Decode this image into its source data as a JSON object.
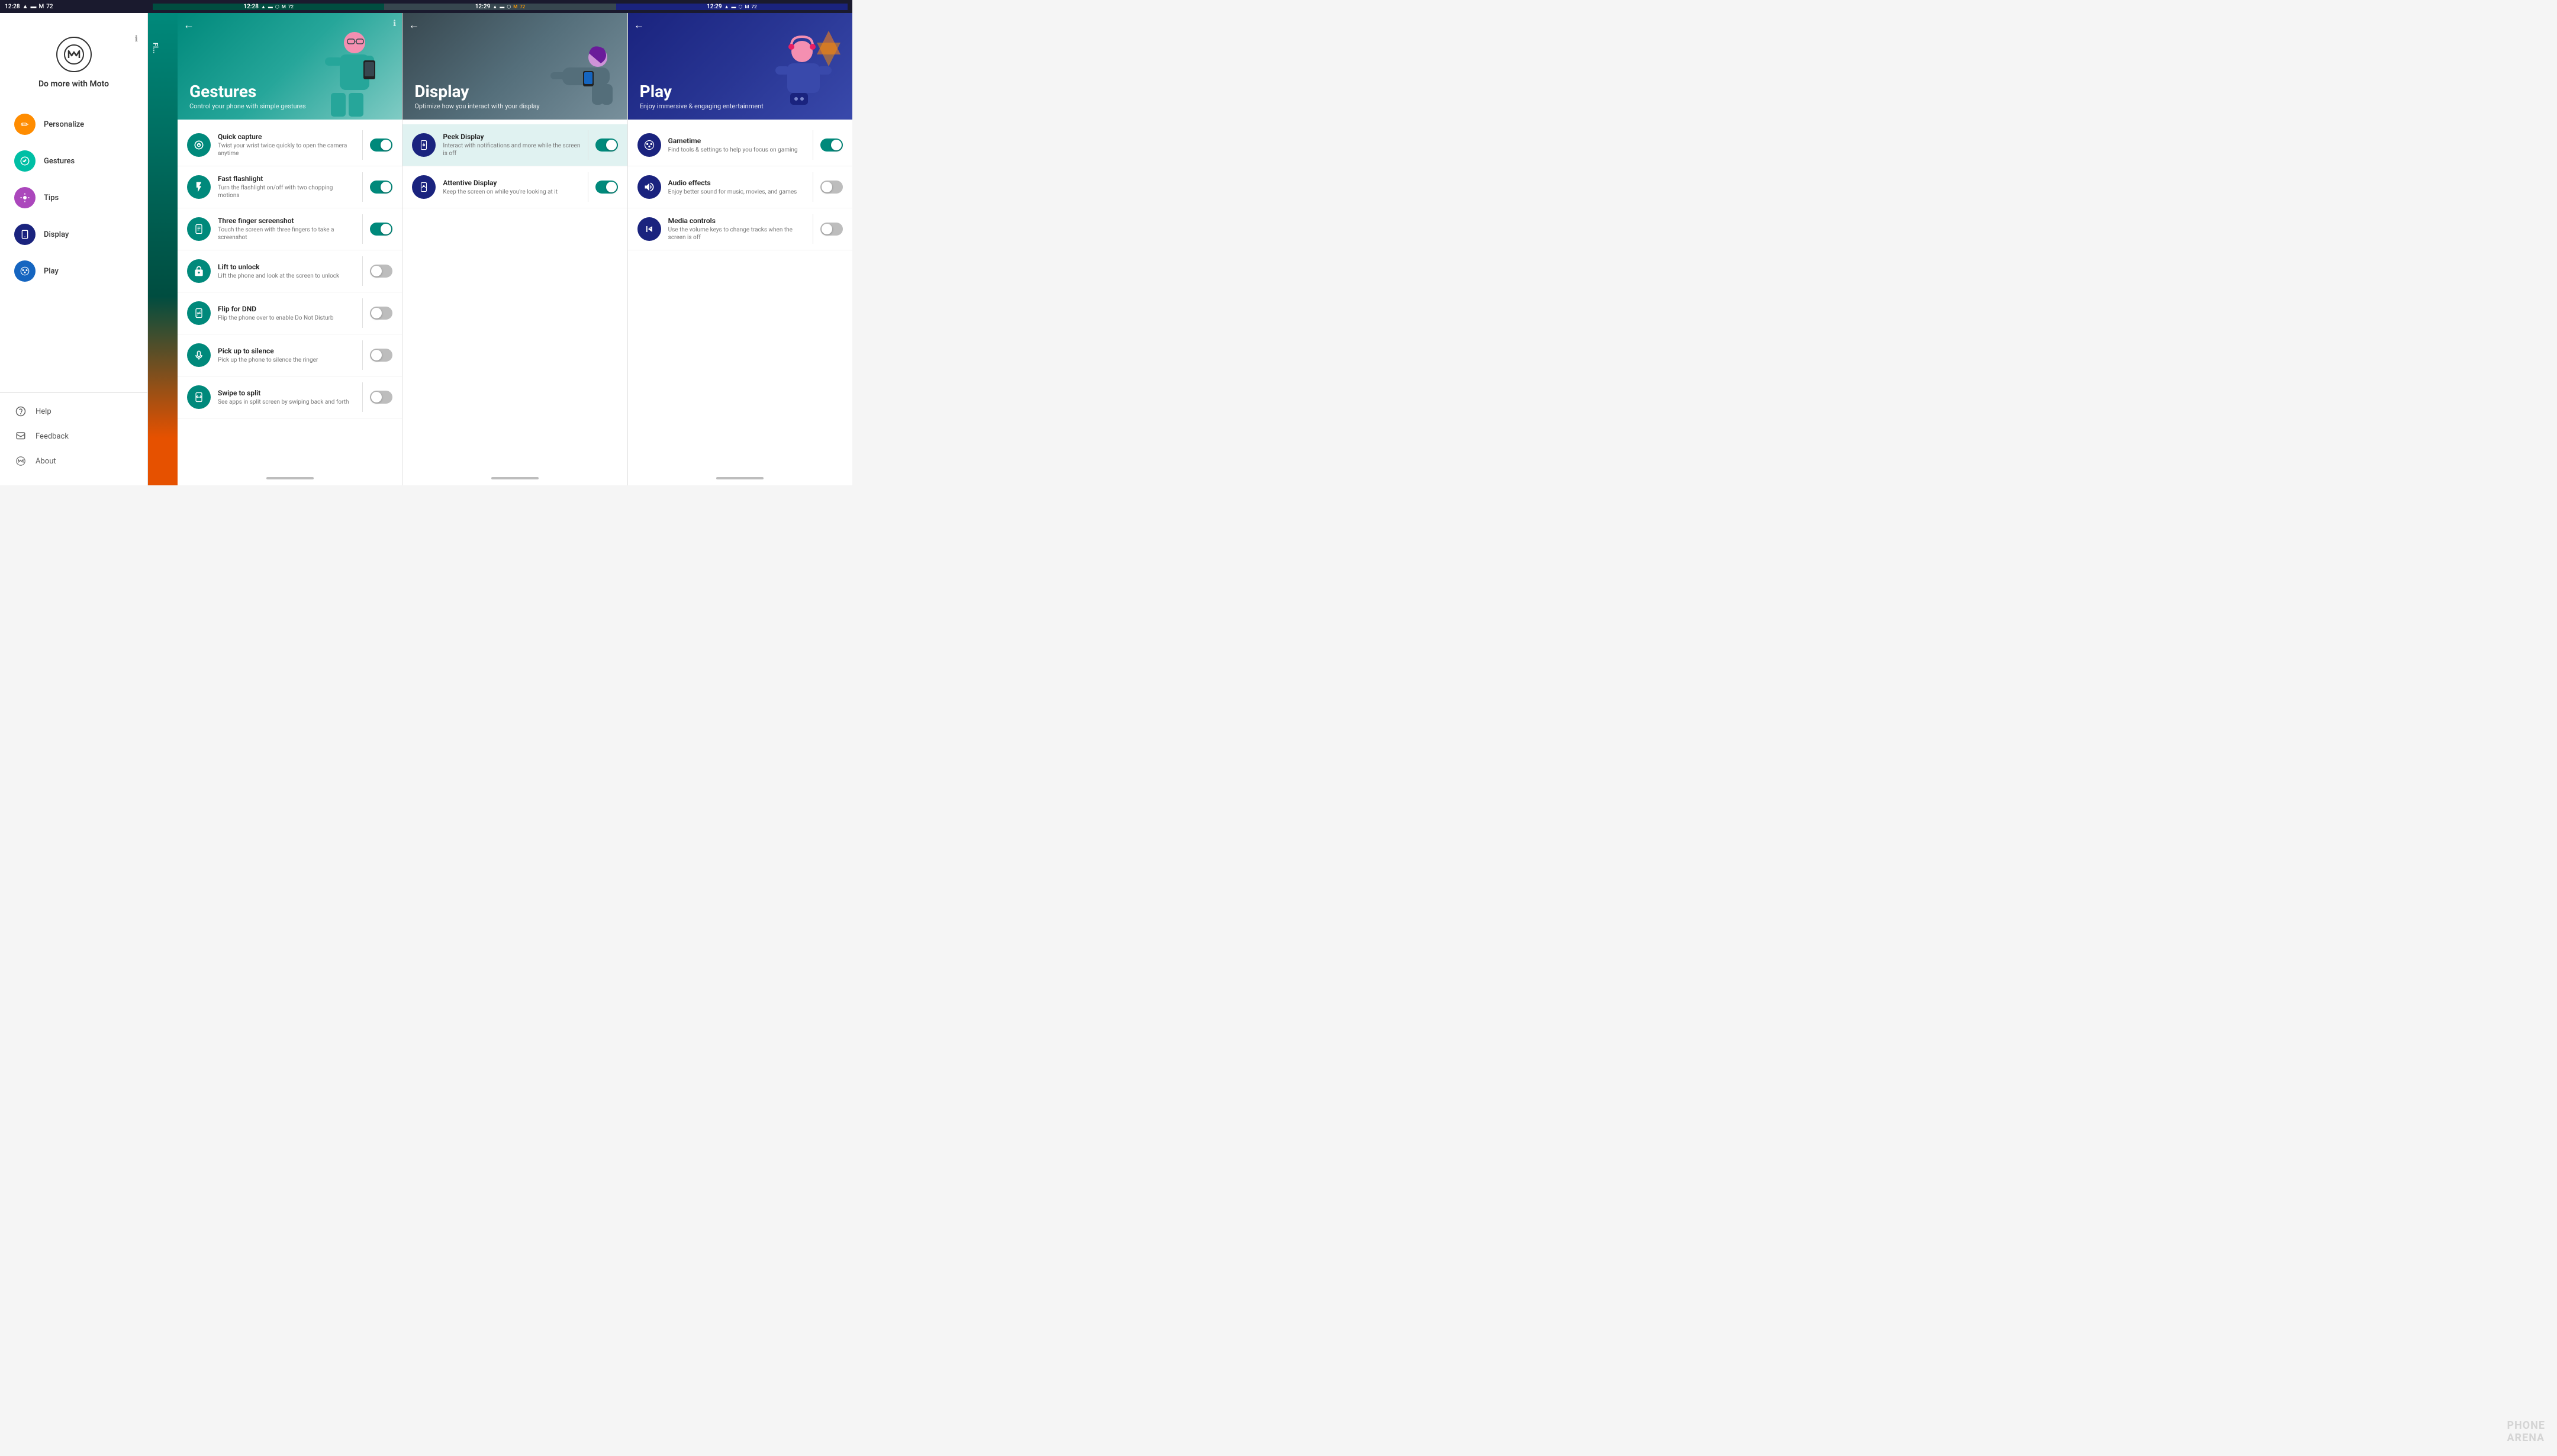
{
  "statusBar": {
    "sections": [
      {
        "time": "12:28",
        "icons": [
          "wifi",
          "battery",
          "signal"
        ]
      },
      {
        "time": "12:28",
        "icons": [
          "wifi",
          "battery",
          "signal",
          "cast",
          "mail",
          "72"
        ]
      },
      {
        "time": "12:29",
        "icons": [
          "wifi",
          "battery",
          "signal",
          "cast",
          "mail",
          "72"
        ]
      },
      {
        "time": "12:29",
        "icons": [
          "wifi",
          "battery",
          "signal",
          "cast",
          "mail",
          "72"
        ]
      }
    ]
  },
  "sidebar": {
    "logo_alt": "Motorola",
    "title": "Do more with Moto",
    "navItems": [
      {
        "id": "personalize",
        "label": "Personalize",
        "iconColor": "orange",
        "iconSymbol": "✏"
      },
      {
        "id": "gestures",
        "label": "Gestures",
        "iconColor": "teal",
        "iconSymbol": "👋"
      },
      {
        "id": "tips",
        "label": "Tips",
        "iconColor": "purple",
        "iconSymbol": "💡"
      },
      {
        "id": "display",
        "label": "Display",
        "iconColor": "navy",
        "iconSymbol": "📱"
      },
      {
        "id": "play",
        "label": "Play",
        "iconColor": "blue-dark",
        "iconSymbol": "🎮"
      }
    ],
    "footerItems": [
      {
        "id": "help",
        "label": "Help",
        "iconSymbol": "?"
      },
      {
        "id": "feedback",
        "label": "Feedback",
        "iconSymbol": "💬"
      },
      {
        "id": "about",
        "label": "About",
        "iconSymbol": "M"
      }
    ]
  },
  "gesturesPanel": {
    "title": "Gestures",
    "subtitle": "Control your phone with simple gestures",
    "settings": [
      {
        "id": "quick-capture",
        "name": "Quick capture",
        "desc": "Twist your wrist twice quickly to open the camera anytime",
        "toggleOn": true
      },
      {
        "id": "fast-flashlight",
        "name": "Fast flashlight",
        "desc": "Turn the flashlight on/off with two chopping motions",
        "toggleOn": true
      },
      {
        "id": "three-finger-screenshot",
        "name": "Three finger screenshot",
        "desc": "Touch the screen with three fingers to take a screenshot",
        "toggleOn": true
      },
      {
        "id": "lift-to-unlock",
        "name": "Lift to unlock",
        "desc": "Lift the phone and look at the screen to unlock",
        "toggleOn": false
      },
      {
        "id": "flip-for-dnd",
        "name": "Flip for DND",
        "desc": "Flip the phone over to enable Do Not Disturb",
        "toggleOn": false
      },
      {
        "id": "pick-up-to-silence",
        "name": "Pick up to silence",
        "desc": "Pick up the phone to silence the ringer",
        "toggleOn": false
      },
      {
        "id": "swipe-to-split",
        "name": "Swipe to split",
        "desc": "See apps in split screen by swiping back and forth",
        "toggleOn": false
      }
    ]
  },
  "displayPanel": {
    "title": "Display",
    "subtitle": "Optimize how you interact with your display",
    "settings": [
      {
        "id": "peek-display",
        "name": "Peek Display",
        "desc": "Interact with notifications and more while the screen is off",
        "toggleOn": true,
        "highlighted": true,
        "iconDark": true
      },
      {
        "id": "attentive-display",
        "name": "Attentive Display",
        "desc": "Keep the screen on while you're looking at it",
        "toggleOn": true,
        "iconDark": true
      }
    ]
  },
  "playPanel": {
    "title": "Play",
    "subtitle": "Enjoy immersive & engaging entertainment",
    "settings": [
      {
        "id": "gametime",
        "name": "Gametime",
        "desc": "Find tools & settings to help you focus on gaming",
        "toggleOn": true
      },
      {
        "id": "audio-effects",
        "name": "Audio effects",
        "desc": "Enjoy better sound for music, movies, and games",
        "toggleOn": false
      },
      {
        "id": "media-controls",
        "name": "Media controls",
        "desc": "Use the volume keys to change tracks when the screen is off",
        "toggleOn": false
      }
    ]
  },
  "watermark": "PHONE\nARENA"
}
